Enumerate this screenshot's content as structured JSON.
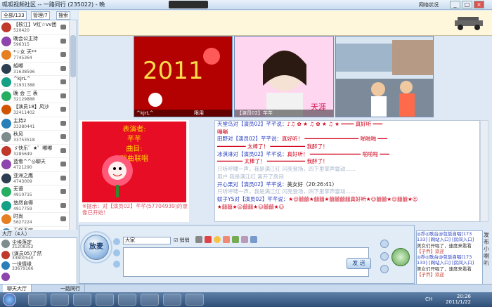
{
  "window": {
    "title": "呱呱视频社区 -- 一路同行 (235022) - 晚",
    "network_status": "网络状况"
  },
  "left_tabs": {
    "all": "全部/133",
    "admin": "管理/7",
    "search": "搜索"
  },
  "users": [
    {
      "name": "【核江】V红☆vv团",
      "id": "520420",
      "color": "#c0392b"
    },
    {
      "name": "晚会公主持",
      "id": "596315",
      "color": "#8e44ad"
    },
    {
      "name": "*☆女 天**",
      "id": "7745364",
      "color": "#e67e22"
    },
    {
      "name": "船嘟",
      "id": "31638596",
      "color": "#2c3e50"
    },
    {
      "name": "^kjrL^",
      "id": "31931388",
      "color": "#16a085"
    },
    {
      "name": "晚 会 三 表",
      "id": "32129888",
      "color": "#27ae60"
    },
    {
      "name": "【演员18】风沙",
      "id": "32411402",
      "color": "#d35400"
    },
    {
      "name": "主持2",
      "id": "33380441",
      "color": "#2980b9"
    },
    {
      "name": "秋风",
      "id": "33753518",
      "color": "#7f8c8d"
    },
    {
      "name": "ゞ快乐゛★゜嘟嘟",
      "id": "3285649",
      "color": "#c0392b"
    },
    {
      "name": "蓝看^^◎聊天",
      "id": "4721290",
      "color": "#8e44ad"
    },
    {
      "name": "亚洲之鹰",
      "id": "4743009",
      "color": "#2c3e50"
    },
    {
      "name": "无语",
      "id": "4910715",
      "color": "#27ae60"
    },
    {
      "name": "悠然自得",
      "id": "4917759",
      "color": "#16a085"
    },
    {
      "name": "时尚",
      "id": "5627224",
      "color": "#e67e22"
    },
    {
      "name": "无怪不欢",
      "id": "31018170",
      "color": "#2980b9"
    }
  ],
  "hall": {
    "header": "大厅（4人）",
    "users": [
      {
        "name": "尘埃落定",
        "id": "31208352",
        "color": "#7f8c8d"
      },
      {
        "name": "(演员05)了然",
        "id": "33800540",
        "color": "#c0392b"
      },
      {
        "name": "一世情缘",
        "id": "33679166",
        "color": "#2980b9"
      },
      {
        "name": "",
        "id": "",
        "color": "#8e44ad"
      }
    ]
  },
  "videos": [
    {
      "caption": "限用",
      "name": "^kjrL^",
      "colors": [
        "#b30000",
        "#ffdb4d"
      ]
    },
    {
      "caption": "【演员02】芊芊",
      "name": "天涯",
      "colors": [
        "#ffd6f0",
        "#f6f2e6"
      ]
    },
    {
      "caption": "",
      "name": "",
      "colors": [
        "#4d79b3",
        "#d9e6f2"
      ]
    }
  ],
  "performance": {
    "label1": "表演者:",
    "performer": "芊芊",
    "label2": "曲目:",
    "song": "戏曲联唱",
    "tip": "※提示：对【演员02】芊芊(57704939)的录像已开始！"
  },
  "chat": [
    {
      "user": "天堂鸟对【演员02】芊芊说：",
      "body": "♪♫ ✿ ★ ♫ ✿ ★ ♫ ★ ━━━━ 真好听 ━━━",
      "cls": "red"
    },
    {
      "user": "",
      "body": "嘣嘣",
      "cls": "red"
    },
    {
      "user": "田野对【演员02】芊芊说：",
      "body": "真好听！ ━━━━━━━━━━━━━━━━━ 啪啪啪 ━━━",
      "cls": "red"
    },
    {
      "user": "",
      "body": "━━━━━━━━━ 太棒了！ ━━━━━━━━━━━ 我醉了！",
      "cls": "red"
    },
    {
      "user": "冰淇淋对【演员02】芊芊说：",
      "body": "真好听！ ━━━━━━━━━━━━━━━━ 啪啪啪 ━━━",
      "cls": "red"
    },
    {
      "user": "",
      "body": "━━━━━━━━ 太棒了！ ━━━━━━━━━━━━ 我醉了！",
      "cls": "red"
    },
    {
      "user": "",
      "body": "只听呼啸一声，我是满江红 闪亮登场，四下里掌声雷动......",
      "cls": "gry"
    },
    {
      "user": "",
      "body": "用户 我是满江红 离开了房间",
      "cls": "gry"
    },
    {
      "user": "开心果对【演员02】芊芊说：",
      "body": "美女好（20:26:41）",
      "cls": "nmv"
    },
    {
      "user": "",
      "body": "只听呼啸一声，我是满江红 闪亮登场，四下里掌声雷动......",
      "cls": "gry"
    },
    {
      "user": "蚊子YS对【演员02】芊芊说：",
      "body": "★☺囍囍★囍囍★囍囍囍囍真好听★☺囍囍★☺囍囍★☺",
      "cls": "red"
    },
    {
      "user": "",
      "body": "★囍囍★☺囍囍★☺囍囍★☺",
      "cls": "red"
    }
  ],
  "bottom": {
    "mic_label": "放麦",
    "to_user": "大家",
    "private_label": "悄悄",
    "send_label": "发 送"
  },
  "public_messages": [
    {
      "text": "◎乔◎歌台@包饭自唱[173",
      "color": "#2a40c0"
    },
    {
      "text": "133] [网站入口] [房间入口]",
      "color": "#2a40c0"
    },
    {
      "text": "美女们开唱了，速度来看看",
      "color": "#333"
    },
    {
      "text": "【子乔】欢迎",
      "color": "#c0392b"
    },
    {
      "text": "◎乔◎歌台@包饭自唱[173",
      "color": "#2a40c0"
    },
    {
      "text": "133] [网站入口] [房间入口]",
      "color": "#2a40c0"
    },
    {
      "text": "美女们开唱了，速度来看看",
      "color": "#333"
    },
    {
      "text": "【子乔】欢迎",
      "color": "#c0392b"
    }
  ],
  "side_vertical_text": "发布小喇叭",
  "room_tabs": [
    "聊天大厅",
    "一路同行"
  ],
  "taskbar": {
    "lang": "CH",
    "time": "20:26",
    "date": "2011/1/22"
  }
}
